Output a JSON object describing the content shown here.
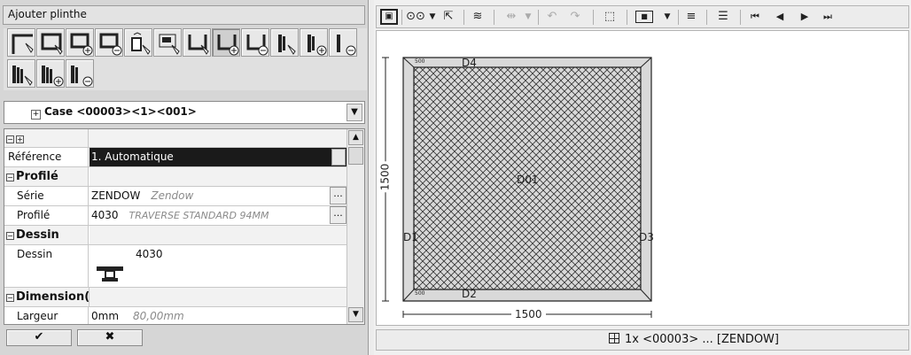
{
  "panel": {
    "title": "Ajouter plinthe",
    "case_label": "Case <00003><1><001>"
  },
  "toolbar_tools": [
    {
      "name": "select-corner-tool"
    },
    {
      "name": "select-frame-tool"
    },
    {
      "name": "add-frame-tool"
    },
    {
      "name": "remove-frame-tool"
    },
    {
      "name": "place-item-tool"
    },
    {
      "name": "select-inner-tool"
    },
    {
      "name": "select-u-tool"
    },
    {
      "name": "add-u-tool",
      "selected": true
    },
    {
      "name": "remove-u-tool"
    },
    {
      "name": "select-profile-tool"
    },
    {
      "name": "add-profile-tool"
    },
    {
      "name": "remove-profile-tool"
    },
    {
      "name": "select-multi-profile-tool"
    },
    {
      "name": "add-multi-profile-tool"
    },
    {
      "name": "remove-multi-profile-tool"
    }
  ],
  "properties": {
    "reference": {
      "label": "Référence",
      "value": "1. Automatique"
    },
    "profile_section": "Profilé",
    "serie": {
      "label": "Série",
      "value": "ZENDOW",
      "hint": "Zendow"
    },
    "profile": {
      "label": "Profilé",
      "value": "4030",
      "hint": "TRAVERSE STANDARD 94MM"
    },
    "drawing_section": "Dessin",
    "drawing": {
      "label": "Dessin",
      "value": "4030"
    },
    "dimension_section": "Dimension(",
    "width": {
      "label": "Largeur",
      "value": "0mm",
      "hint": "80,00mm"
    },
    "dots": "..."
  },
  "buttons": {
    "ok": "✔",
    "cancel": "✖"
  },
  "drawing": {
    "top_label": "D4",
    "left_label": "D1",
    "right_label": "D3",
    "bottom_label": "D2",
    "center_label": "D01",
    "corner_tl": "500",
    "corner_bl": "500",
    "height_dim": "1500",
    "width_dim": "1500"
  },
  "status": {
    "text": "1x <00003> ... [ZENDOW]"
  }
}
